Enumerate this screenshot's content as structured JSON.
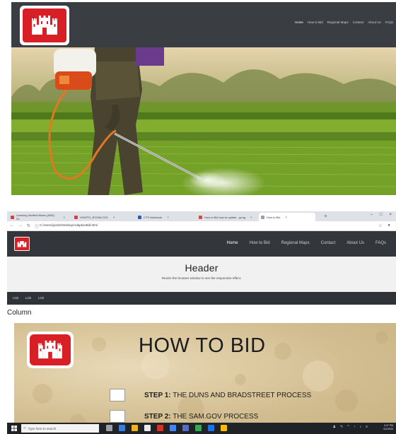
{
  "top_site": {
    "nav_links": [
      "Home",
      "How to Bid",
      "Regional Maps",
      "Contact",
      "About Us",
      "FAQs"
    ],
    "active_link": "Home"
  },
  "browser": {
    "tabs": [
      {
        "label": "Learning Verified Marks (ABD) Sc",
        "favicon_color": "#e53935"
      },
      {
        "label": "HOWTO_ROOM-CDS",
        "favicon_color": "#e53935"
      },
      {
        "label": "CTS Notebook",
        "favicon_color": "#1e63c4"
      },
      {
        "label": "How to Bid how to update - goog",
        "favicon_color": "#ea4335"
      },
      {
        "label": "How to Bid",
        "favicon_color": "#9e9e9e"
      }
    ],
    "url": "C:/Users/justin/Desktop/AdaptiveBid.html"
  },
  "site": {
    "nav_links": [
      "Home",
      "How to Bid",
      "Regional Maps",
      "Contact",
      "About Us",
      "FAQs"
    ],
    "active_link": "Home",
    "header_title": "Header",
    "header_subtitle": "Resize the browser window to see the responsive effect.",
    "subnav_links": [
      "Link",
      "Link",
      "Link"
    ],
    "column_label": "Column"
  },
  "panel": {
    "title": "HOW TO BID",
    "steps": [
      {
        "prefix": "STEP 1:",
        "text": " THE DUNS AND BRADSTREET PROCESS"
      },
      {
        "prefix": "STEP 2:",
        "text": " THE SAM.GOV PROCESS"
      }
    ]
  },
  "taskbar": {
    "search_placeholder": "Type here to search",
    "clock_time": "3:47 PM",
    "clock_date": "6/1/2020"
  },
  "colors": {
    "brand_red": "#d81f26",
    "nav_dark": "#33363a",
    "panel_parchment": "#dcc9a0"
  }
}
